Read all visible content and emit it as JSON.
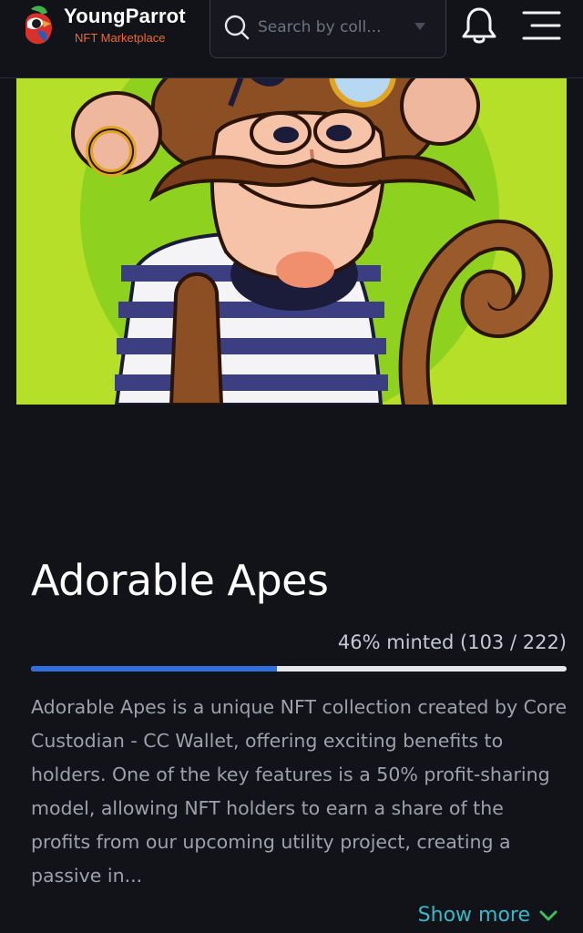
{
  "header": {
    "brand_name": "YoungParrot",
    "brand_tagline": "NFT Marketplace",
    "search": {
      "placeholder": "Search by coll..."
    }
  },
  "icons": [
    "parrot-logo-icon",
    "search-icon",
    "chevron-down-icon",
    "bell-icon",
    "menu-icon"
  ],
  "collection": {
    "title": "Adorable Apes",
    "minted_text": "46% minted (103 / 222)",
    "minted_fraction": 0.46,
    "description": "Adorable Apes is a unique NFT collection created by Core Custodian - CC Wallet, offering exciting benefits to holders. One of the key features is a 50% profit-sharing model, allowing NFT holders to earn a share of the profits from our upcoming utility project, creating a passive in...",
    "show_more_label": "Show more"
  },
  "colors": {
    "background": "#121319",
    "accent_blue": "#2f6fe0",
    "link_teal": "#36b9c9",
    "brand_orange": "#f06a2c",
    "hero_green": "#b6df2a"
  }
}
